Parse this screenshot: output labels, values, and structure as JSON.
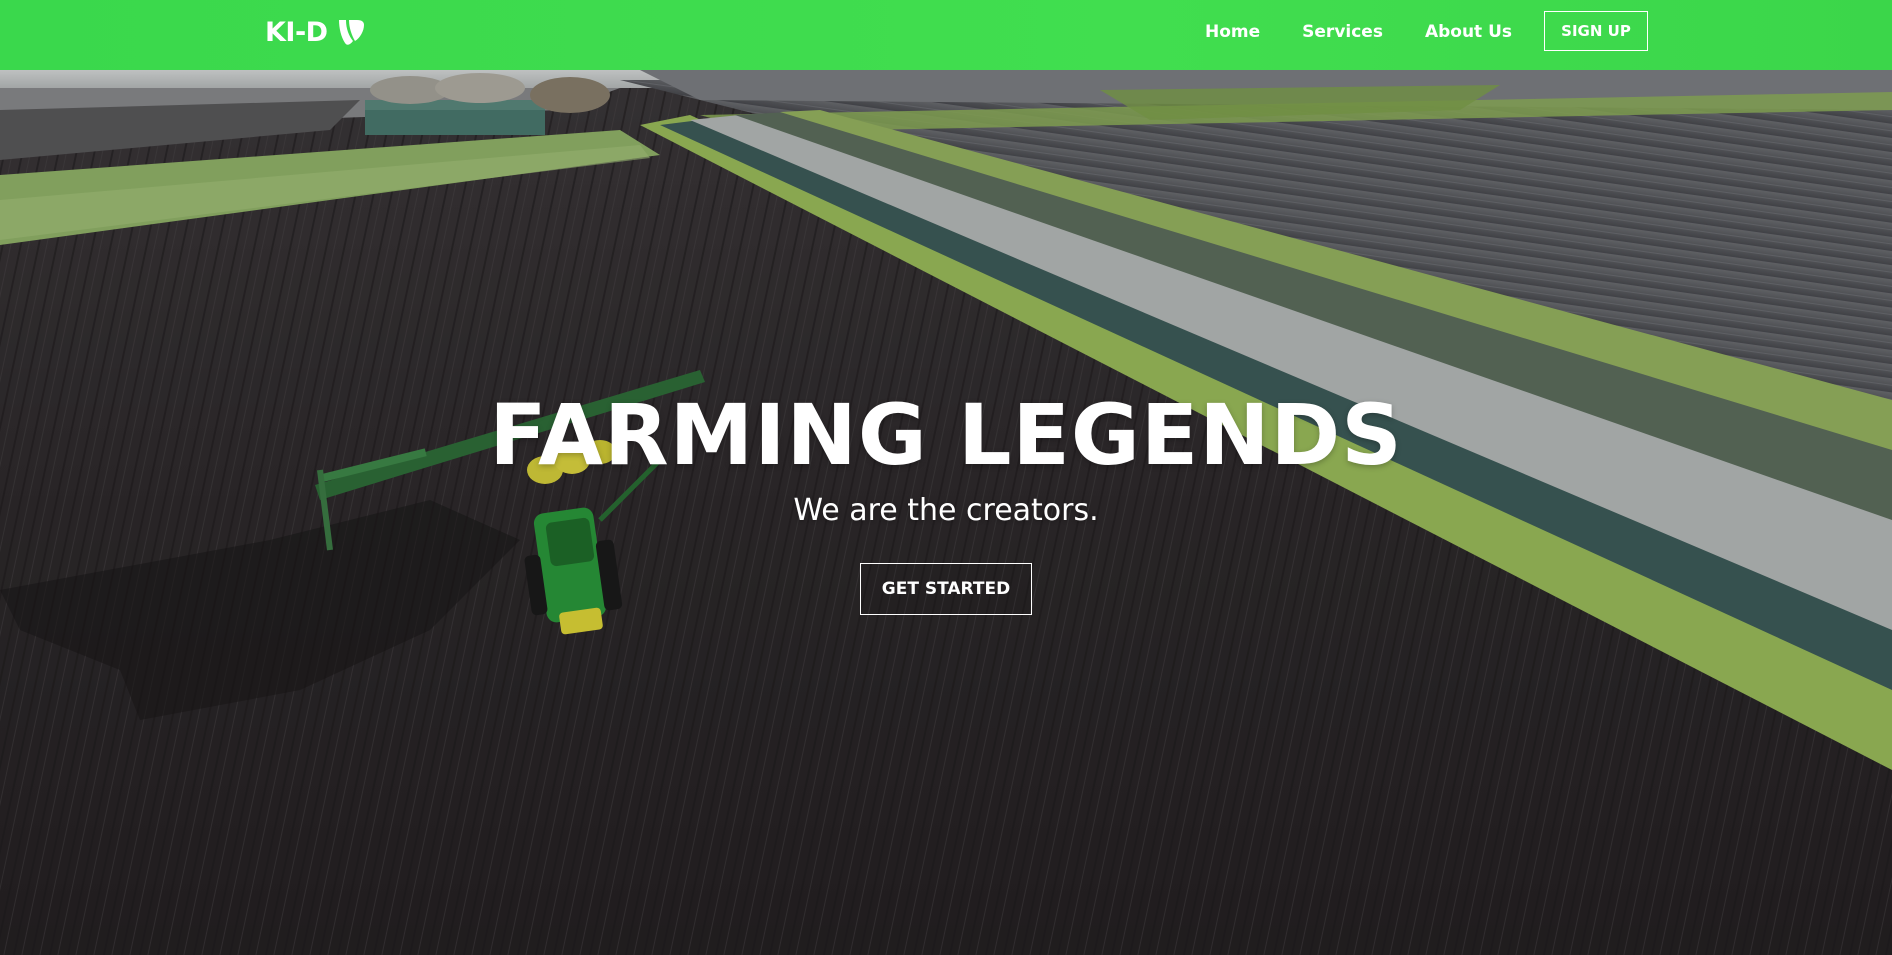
{
  "header": {
    "brand_text": "KI-D",
    "brand_icon": "typo3-logo-icon",
    "nav": [
      {
        "label": "Home"
      },
      {
        "label": "Services"
      },
      {
        "label": "About Us"
      }
    ],
    "signup_label": "SIGN UP",
    "bar_color": "#3fdc4d"
  },
  "hero": {
    "title": "FARMING LEGENDS",
    "subtitle": "We are the creators.",
    "cta_label": "GET STARTED",
    "background": "aerial-farm-field-with-tractor"
  }
}
